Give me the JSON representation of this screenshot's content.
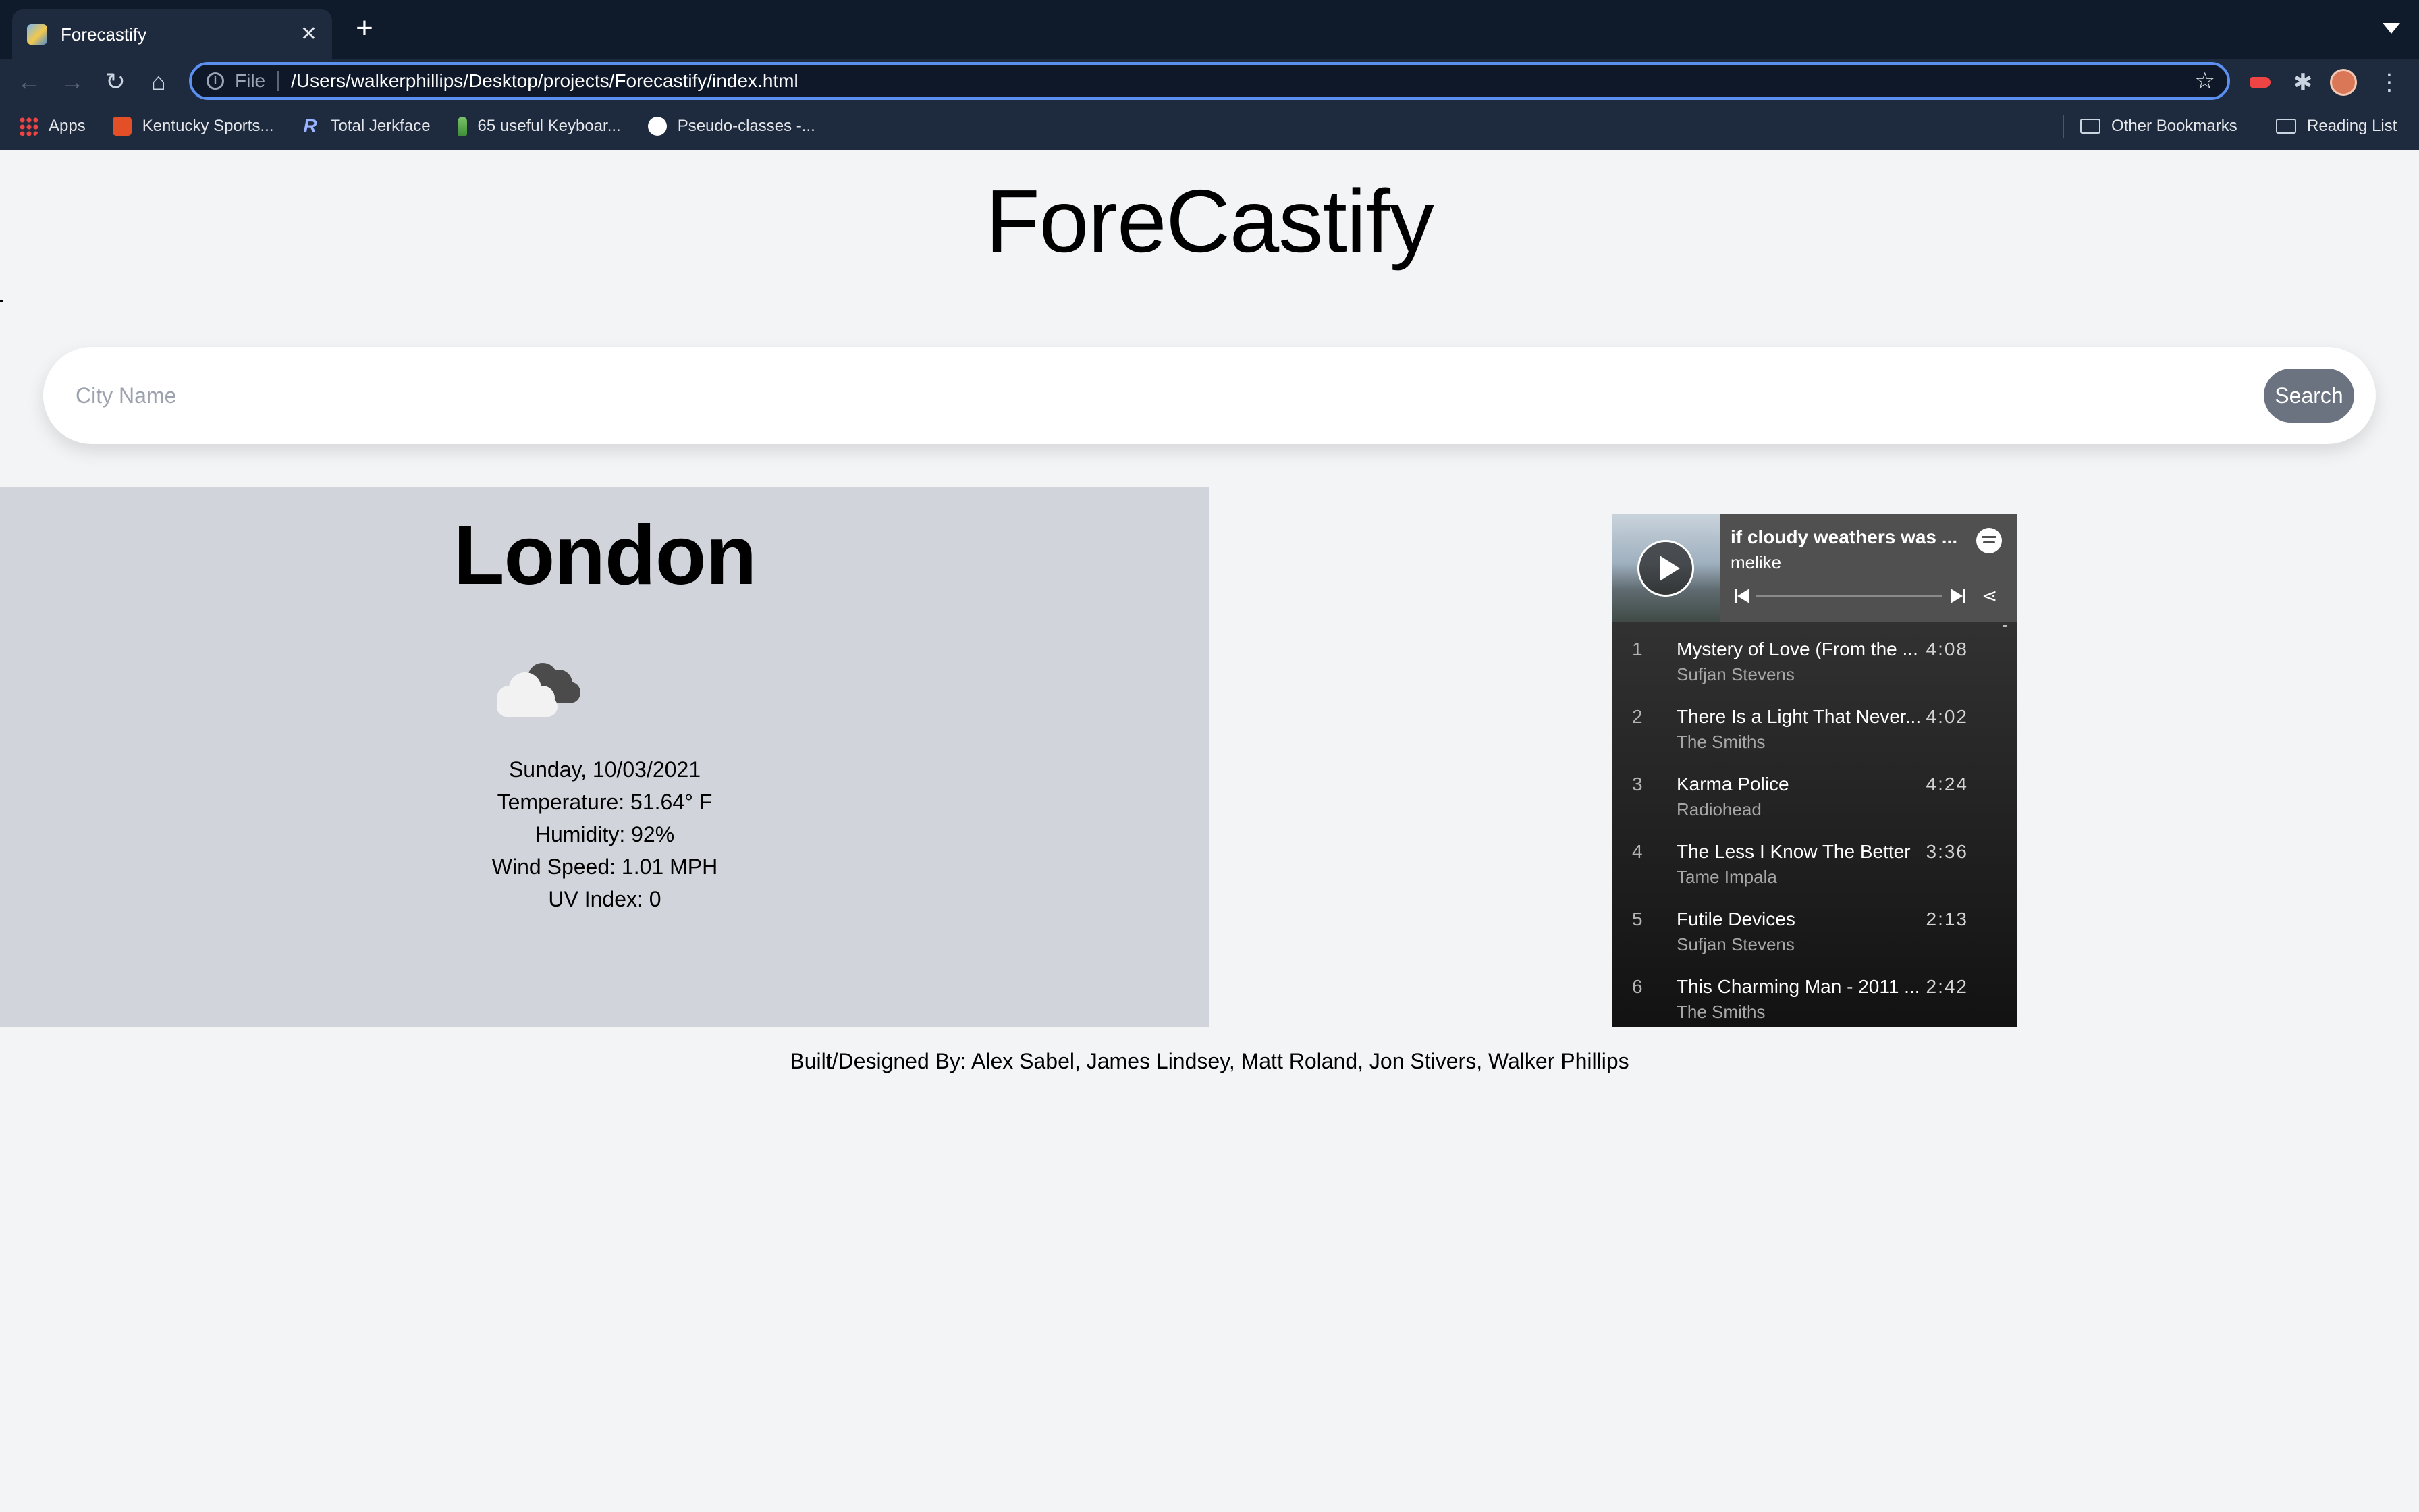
{
  "browser": {
    "tab_title": "Forecastify",
    "tab_close": "✕",
    "new_tab": "+",
    "scheme_label": "File",
    "url": "/Users/walkerphillips/Desktop/projects/Forecastify/index.html",
    "bookmarks": [
      {
        "label": "Apps",
        "icon": "apps-grid-icon"
      },
      {
        "label": "Kentucky Sports...",
        "icon": "html5-icon"
      },
      {
        "label": "Total Jerkface",
        "icon": "r-logo-icon"
      },
      {
        "label": "65 useful Keyboar...",
        "icon": "cactus-icon"
      },
      {
        "label": "Pseudo-classes -...",
        "icon": "mdn-icon"
      }
    ],
    "other_bookmarks": "Other Bookmarks",
    "reading_list": "Reading List"
  },
  "app": {
    "title": "ForeCastify",
    "search": {
      "placeholder": "City Name",
      "value": "",
      "button_label": "Search"
    }
  },
  "weather": {
    "city": "London",
    "icon": "cloudy-icon",
    "date": "Sunday, 10/03/2021",
    "temperature": "Temperature: 51.64° F",
    "humidity": "Humidity: 92%",
    "wind_speed": "Wind Speed: 1.01 MPH",
    "uv_index": "UV Index: 0"
  },
  "spotify": {
    "playlist_title": "if cloudy weathers was ...",
    "owner": "melike",
    "tracks": [
      {
        "num": "1",
        "title": "Mystery of Love (From the ...",
        "artist": "Sufjan Stevens",
        "duration": "4:08"
      },
      {
        "num": "2",
        "title": "There Is a Light That Never...",
        "artist": "The Smiths",
        "duration": "4:02"
      },
      {
        "num": "3",
        "title": "Karma Police",
        "artist": "Radiohead",
        "duration": "4:24"
      },
      {
        "num": "4",
        "title": "The Less I Know The Better",
        "artist": "Tame Impala",
        "duration": "3:36"
      },
      {
        "num": "5",
        "title": "Futile Devices",
        "artist": "Sufjan Stevens",
        "duration": "2:13"
      },
      {
        "num": "6",
        "title": "This Charming Man - 2011 ...",
        "artist": "The Smiths",
        "duration": "2:42"
      }
    ]
  },
  "footer": {
    "credits": "Built/Designed By: Alex Sabel, James Lindsey, Matt Roland, Jon Stivers, Walker Phillips"
  },
  "colors": {
    "page_bg": "#f3f4f6",
    "card_bg": "#d1d5db",
    "search_button": "#6b7280",
    "chrome_bg": "#1e2a3d",
    "omnibox_focus": "#5b8ff0"
  }
}
